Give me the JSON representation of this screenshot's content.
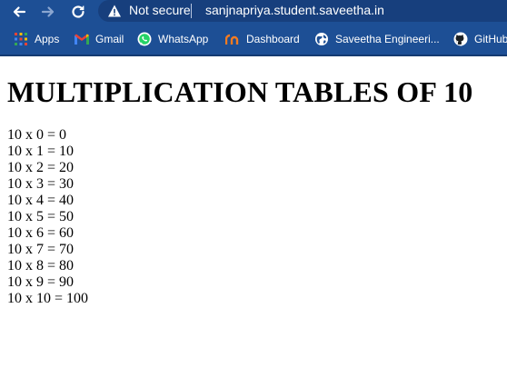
{
  "browser": {
    "security_label": "Not secure",
    "url": "sanjnapriya.student.saveetha.in"
  },
  "bookmarks": [
    {
      "label": "Apps",
      "icon": "apps-grid-icon"
    },
    {
      "label": "Gmail",
      "icon": "gmail-icon"
    },
    {
      "label": "WhatsApp",
      "icon": "whatsapp-icon"
    },
    {
      "label": "Dashboard",
      "icon": "dashboard-icon"
    },
    {
      "label": "Saveetha Engineeri...",
      "icon": "globe-icon"
    },
    {
      "label": "GitHub",
      "icon": "github-icon"
    }
  ],
  "page": {
    "heading": "MULTIPLICATION TABLES OF 10",
    "lines": [
      "10 x 0 = 0",
      "10 x 1 = 10",
      "10 x 2 = 20",
      "10 x 3 = 30",
      "10 x 4 = 40",
      "10 x 5 = 50",
      "10 x 6 = 60",
      "10 x 7 = 70",
      "10 x 8 = 80",
      "10 x 9 = 90",
      "10 x 10 = 100"
    ]
  }
}
